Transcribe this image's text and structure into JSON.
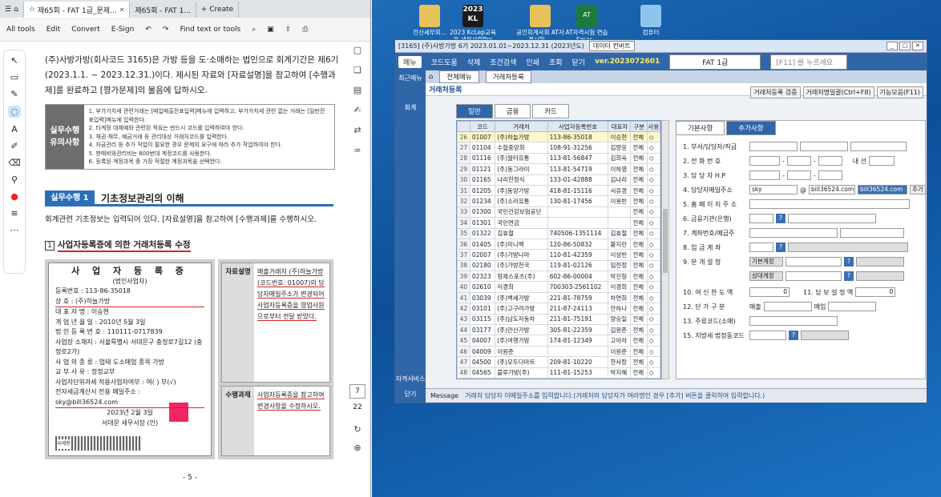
{
  "tabs": [
    "제65회 - FAT 1급_문제...",
    "제65회 - FAT 1..."
  ],
  "new_tab": "+ Create",
  "toolbar": [
    "All tools",
    "Edit",
    "Convert",
    "E-Sign",
    "Find text or tools"
  ],
  "page_current": "7",
  "page_total": "22",
  "doc": {
    "intro": "(주)사방가방(회사코드 3165)은 가방 등을 도·소매하는 법인으로 회계기간은 제6기(2023.1.1. ~ 2023.12.31.)이다. 제시된 자료와 [자료설명]을 참고하여 [수행과제]를 완료하고 [평가문제]의 물음에 답하시오.",
    "guide_label": "실무수행 유의사항",
    "guide_items": [
      "1. 부가가치세 관련거래는 [매입매출전표입력]메뉴에 입력하고, 부가가치세 관련 없는 거래는 [일반전표입력]메뉴에 입력한다.",
      "2. 타계정 대체예와 관련된 적요는 반드시 코드를 입력하여야 한다.",
      "3. 채권·채무, 예금거래 등 관리대상 거래처코드를 입력한다.",
      "4. 자금관리 등 추가 작업이 필요한 경우 문제의 요구에 따라 추가 작업하여야 한다.",
      "5. 판매비와관리비는 800번대 계정코드를 사용한다.",
      "6. 등록된 계정과목 중 가장 적절한 계정과목을 선택한다."
    ],
    "section_num": "실무수행 1",
    "section_title": "기초정보관리의 이해",
    "section_sub": "회계관련 기초정보는 입력되어 있다. [자료설명]을 참고하여 [수행과제]를 수행하시오.",
    "q_num": "1",
    "q_title": "사업자등록증에 의한 거래처등록 수정",
    "cert_title": "사 업 자 등 록 증",
    "cert_sub": "(법인사업자)",
    "cert_lines": [
      "등록번호 : 113-86-35018",
      "상 호 : (주)하늘가방",
      "대 표 자 명 : 이승현",
      "개 업 년 월 일 : 2010년 5월 3일",
      "법 인 등 록 번 호 : 110111-0717839",
      "사업장 소재지 : 서울특별시 서대문구 충정로7길12 (충정로2가)",
      "사 업 의 종 류 : 업태 도소매업 종목 가방",
      "교 부 사 유 : 정정교부",
      "사업자단위과세 적용사업자여부 : 여( ) 부(√)",
      "전자세금계산서 전용 메일주소 : sky@bill36524.com",
      "2023년 2월 3일",
      "서대문 세무서장 (인)"
    ],
    "cert_brand": "국세청",
    "data_key": "자료설명",
    "data_text": "매출거래처 (주)하늘가방 (코드번호: 01007)의 담당자메일주소가 변경되어 사업자등록증을 영업사원으로부터 전달 받았다.",
    "task_key": "수행과제",
    "task_text": "사업자등록증을 참고하여 변경사항을 수정하시오.",
    "page_footer": "- 5 -"
  },
  "desktop_icons": [
    "전산세무회...",
    "2023 KcLep교육용 세무사랑Pro",
    "공인회계사회 AT자격시험 ...",
    "AT자격시험 연습 Smar...",
    "컴퓨터"
  ],
  "app": {
    "title": "[3165] (주)사방가방 6기 2023.01.01~2023.12.31 (2023년도)",
    "title_btn": "데이터 컨버트",
    "version": "ver.2023072601",
    "exam": "FAT 1급",
    "search_placeholder": "[F11] 를 누르세요",
    "menu": [
      "메뉴",
      "코드도움",
      "삭제",
      "조건검색",
      "인쇄",
      "조회",
      "닫기"
    ],
    "side": [
      "최근메뉴",
      "회계",
      "자격서비스",
      "닫기"
    ],
    "top_tabs": [
      "전체메뉴",
      "거래처등록"
    ],
    "page_title": "거래처등록",
    "buttons": [
      "거래처등록 검증",
      "거래처명일괄(Ctrl+F8)",
      "기능모음(F11)"
    ],
    "sub_tabs": [
      "일반",
      "금융",
      "카드"
    ],
    "form_tabs": [
      "기본사항",
      "추가사항"
    ],
    "grid_headers": [
      "",
      "코드",
      "거래처",
      "사업자등록번호",
      "대표자",
      "구분",
      "사용"
    ],
    "rows": [
      [
        "26",
        "01007",
        "(주)하늘가방",
        "113-86-35018",
        "이승현",
        "전체",
        "◇"
      ],
      [
        "27",
        "01104",
        "수협중앙회",
        "108-91-31256",
        "김량윤",
        "전체",
        "◇"
      ],
      [
        "28",
        "01116",
        "(주)월터유통",
        "113-81-56847",
        "김희숙",
        "전체",
        "◇"
      ],
      [
        "29",
        "01121",
        "(주)동그라미",
        "113-81-54719",
        "이하영",
        "전체",
        "◇"
      ],
      [
        "30",
        "01165",
        "나리한정식",
        "133-01-42888",
        "김나리",
        "전체",
        "◇"
      ],
      [
        "31",
        "01205",
        "(주)동양가방",
        "418-81-15116",
        "서유경",
        "전체",
        "◇"
      ],
      [
        "32",
        "01234",
        "(주)소라유통",
        "130-81-17456",
        "이용빈",
        "전체",
        "◇"
      ],
      [
        "33",
        "01300",
        "국민건강보험공단",
        "",
        "",
        "전체",
        "◇"
      ],
      [
        "34",
        "01301",
        "국민연금",
        "",
        "",
        "전체",
        "◇"
      ],
      [
        "35",
        "01322",
        "김효철",
        "740506-1351114",
        "김효철",
        "전체",
        "◇"
      ],
      [
        "36",
        "01405",
        "(주)미니백",
        "120-86-50832",
        "황지만",
        "전체",
        "◇"
      ],
      [
        "37",
        "02007",
        "(주)가방나라",
        "110-81-42359",
        "이성빈",
        "전체",
        "◇"
      ],
      [
        "38",
        "02180",
        "(주)가방천국",
        "119-81-02126",
        "임현정",
        "전체",
        "◇"
      ],
      [
        "39",
        "02323",
        "형제스포츠(주)",
        "602-86-00004",
        "박진형",
        "전체",
        "◇"
      ],
      [
        "40",
        "02610",
        "이경희",
        "700303-2561102",
        "이경희",
        "전체",
        "◇"
      ],
      [
        "41",
        "03039",
        "(주)백세가방",
        "221-81-78759",
        "차연희",
        "전체",
        "◇"
      ],
      [
        "42",
        "03101",
        "(주)고구려가방",
        "211-87-24113",
        "안하나",
        "전체",
        "◇"
      ],
      [
        "43",
        "03115",
        "(주)남도자동차",
        "211-81-75191",
        "양승일",
        "전체",
        "◇"
      ],
      [
        "44",
        "03177",
        "(주)만산가방",
        "305-81-22359",
        "김원준",
        "전체",
        "◇"
      ],
      [
        "45",
        "04007",
        "(주)여행가방",
        "174-81-12349",
        "고아라",
        "전체",
        "◇"
      ],
      [
        "46",
        "04009",
        "이원준",
        "",
        "이원준",
        "전체",
        "◇"
      ],
      [
        "47",
        "04500",
        "(주)모두다마트",
        "209-81-10220",
        "한사랑",
        "전체",
        "◇"
      ],
      [
        "48",
        "04565",
        "블루가방(주)",
        "111-81-15253",
        "박지혜",
        "전체",
        "◇"
      ]
    ],
    "form": {
      "l1": "1. 부서/담당자/직급",
      "l2": "2. 전 화 번 호",
      "l2b": "내 선",
      "l3": "3. 담 당 자 H.P",
      "l4": "4. 담당자메일주소",
      "l4_local": "sky",
      "l4_at": "@",
      "l4_domain": "bill36524.com",
      "l4_sel": "bill36524.com",
      "l4_add": "추가",
      "l5": "5. 홈 페 이 지 주 소",
      "l6": "6. 금융기관(은행)",
      "l7": "7. 계좌번호/예금주",
      "l8": "8. 입 금 계 좌",
      "l9": "9. 분 개 설 정",
      "l9a": "기본계정",
      "l9b": "상대계정",
      "l10": "10. 여 신 한 도 액",
      "l10_val": "0",
      "l11": "11. 담 보 설 정 액",
      "l11_val": "0",
      "l12": "12. 단 가 구 분",
      "l12a": "매출",
      "l12b": "매입",
      "l13": "13. 주류코드(소매)",
      "l15": "15. 지방세 법정동코드"
    },
    "msg_label": "Message",
    "msg": "거래처 담당자 이메일주소를 입력합니다.(거래처의 담당자가 여러명인 경우 [추가] 버튼을 클릭하여 입력합니다.)"
  }
}
